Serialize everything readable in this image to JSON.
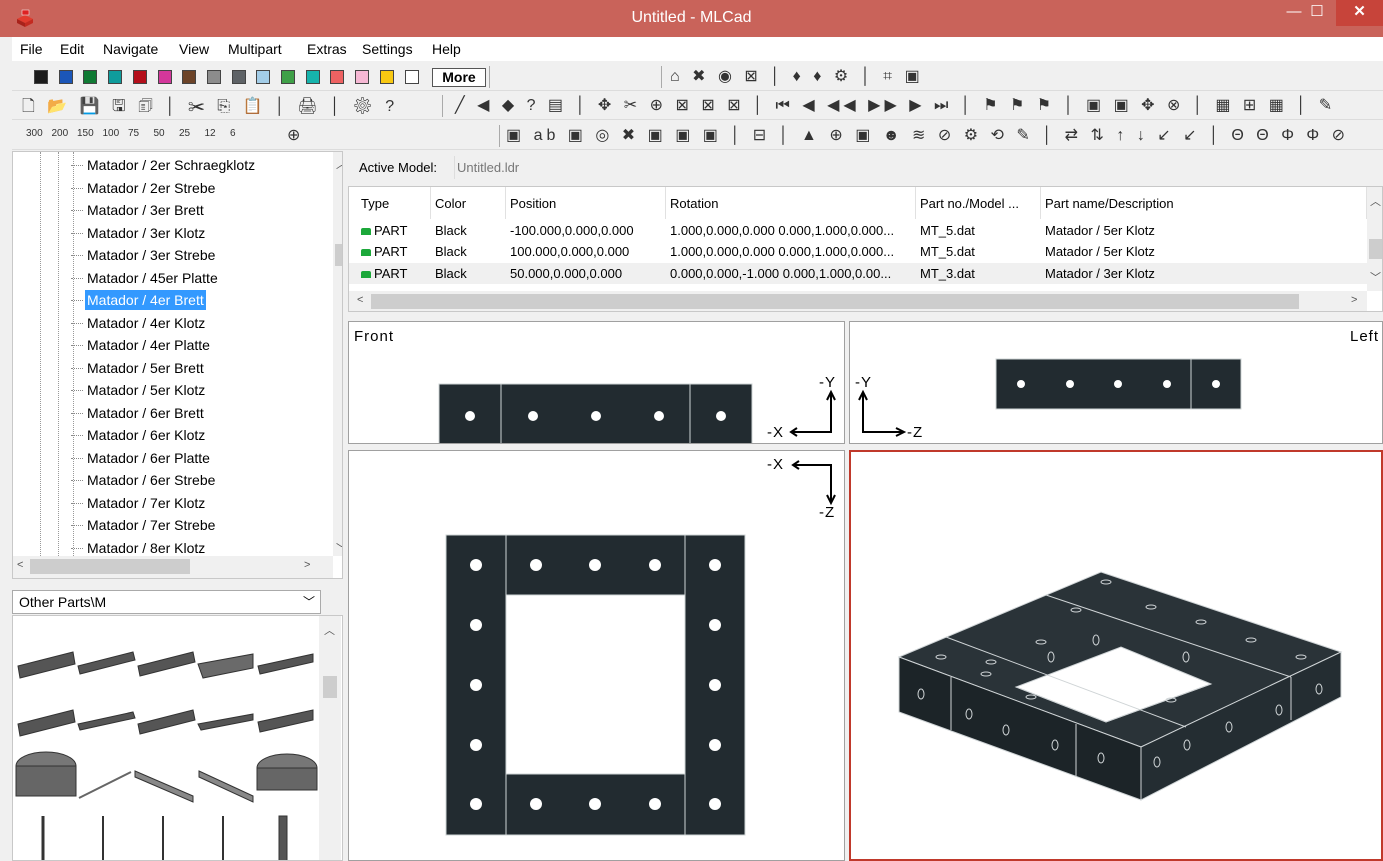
{
  "window": {
    "title": "Untitled - MLCad",
    "minimize": "—",
    "maximize": "☐",
    "close": "✕"
  },
  "menu": [
    "File",
    "Edit",
    "Navigate",
    "View",
    "Multipart",
    "Extras",
    "Settings",
    "Help"
  ],
  "colors_toolbar": {
    "swatches": [
      "#1c1c1c",
      "#1b56b8",
      "#107a34",
      "#0f9c9c",
      "#b40f1b",
      "#d3379b",
      "#6c4328",
      "#8c8c8c",
      "#5e6266",
      "#a3cde8",
      "#3fa048",
      "#16b3ac",
      "#ee6262",
      "#f6b8d4",
      "#f8c812",
      "#ffffff"
    ],
    "more_label": "More"
  },
  "zoom_buttons": [
    "300",
    "200",
    "150",
    "100",
    "75",
    "50",
    "25",
    "12",
    "6"
  ],
  "parts_tree": {
    "items": [
      "Matador / 2er Schraegklotz",
      "Matador / 2er Strebe",
      "Matador / 3er Brett",
      "Matador / 3er Klotz",
      "Matador / 3er Strebe",
      "Matador / 45er Platte",
      "Matador / 4er Brett",
      "Matador / 4er Klotz",
      "Matador / 4er Platte",
      "Matador / 5er Brett",
      "Matador / 5er Klotz",
      "Matador / 6er Brett",
      "Matador / 6er Klotz",
      "Matador / 6er Platte",
      "Matador / 6er Strebe",
      "Matador / 7er Klotz",
      "Matador / 7er Strebe",
      "Matador / 8er Klotz"
    ],
    "selected_index": 6
  },
  "parts_category": "Other Parts\\M",
  "active_model": {
    "label": "Active Model:",
    "value": "Untitled.ldr"
  },
  "table": {
    "headers": [
      "Type",
      "Color",
      "Position",
      "Rotation",
      "Part no./Model ...",
      "Part name/Description"
    ],
    "rows": [
      {
        "type": "PART",
        "color": "Black",
        "position": "-100.000,0.000,0.000",
        "rotation": "1.000,0.000,0.000 0.000,1.000,0.000...",
        "part_no": "MT_5.dat",
        "description": "Matador / 5er Klotz"
      },
      {
        "type": "PART",
        "color": "Black",
        "position": "100.000,0.000,0.000",
        "rotation": "1.000,0.000,0.000 0.000,1.000,0.000...",
        "part_no": "MT_5.dat",
        "description": "Matador / 5er Klotz"
      },
      {
        "type": "PART",
        "color": "Black",
        "position": "50.000,0.000,0.000",
        "rotation": "0.000,0.000,-1.000 0.000,1.000,0.00...",
        "part_no": "MT_3.dat",
        "description": "Matador / 3er Klotz"
      }
    ]
  },
  "views": {
    "front": {
      "label": "Front",
      "axis_h": "-X",
      "axis_v": "-Y"
    },
    "left": {
      "label": "Left",
      "axis_h": "-Z",
      "axis_v": "-Y"
    },
    "top": {
      "axis_h": "-X",
      "axis_v": "-Z"
    },
    "model_color": "#222b30",
    "active_border": "#c0392b"
  }
}
